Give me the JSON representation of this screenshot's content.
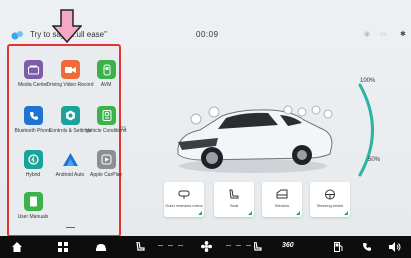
{
  "status": {
    "voice_hint": "Try to say \"...ull ease\"",
    "clock": "00:09",
    "icons": [
      "wifi-icon",
      "battery-icon",
      "bluetooth-icon"
    ]
  },
  "colors": {
    "highlight_border": "#e3342f",
    "arrow_fill": "#f6a7c6",
    "arc": "#2bb3a3",
    "dock_bg": "#0d0d0d"
  },
  "apps": [
    {
      "label": "Media Center",
      "icon": "media-center-icon",
      "color": "#7b5ea7"
    },
    {
      "label": "Driving Video Record",
      "icon": "dashcam-icon",
      "color": "#ef6b3a"
    },
    {
      "label": "AVM",
      "icon": "avm-icon",
      "color": "#3bb34a"
    },
    {
      "label": "Bluetooth Phone",
      "icon": "phone-icon",
      "color": "#1f74d1"
    },
    {
      "label": "Controls & Settings",
      "icon": "settings-icon",
      "color": "#1aa39a"
    },
    {
      "label": "Vehicle Conditions",
      "icon": "vehicle-conditions-icon",
      "color": "#3bb34a"
    },
    {
      "label": "Hybrid",
      "icon": "hybrid-icon",
      "color": "#1aa39a"
    },
    {
      "label": "Android Auto",
      "icon": "android-auto-icon",
      "color": "#1f74d1"
    },
    {
      "label": "Apple CarPlay",
      "icon": "carplay-icon",
      "color": "#8b8f94"
    },
    {
      "label": "User Manuals",
      "icon": "user-manuals-icon",
      "color": "#3bb34a"
    }
  ],
  "gauge": {
    "top_label": "100%",
    "bottom_label": "50%"
  },
  "partial_text": "ps",
  "quick_controls": [
    {
      "label": "Outer rearview mirror",
      "icon": "mirror-icon"
    },
    {
      "label": "Seat",
      "icon": "seat-icon"
    },
    {
      "label": "Window",
      "icon": "window-icon"
    },
    {
      "label": "Steering wheel",
      "icon": "steering-wheel-icon"
    }
  ],
  "dock": {
    "items": [
      "home-icon",
      "apps-grid-icon",
      "car-icon",
      "seat-heat-icon",
      "fan-icon",
      "defrost-icon",
      "360-view-icon",
      "fuel-icon",
      "phone-icon",
      "volume-icon"
    ],
    "fan_dashes": "- - -",
    "view_360_label": "360"
  }
}
